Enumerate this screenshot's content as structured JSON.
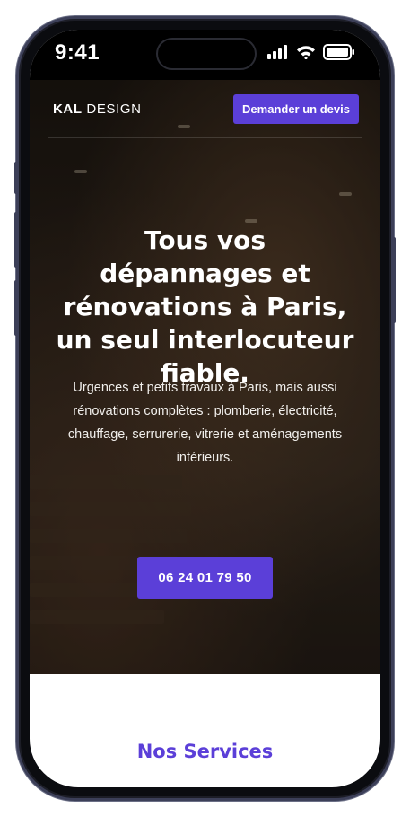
{
  "status_bar": {
    "time": "9:41",
    "icons": [
      "cellular-signal-icon",
      "wifi-icon",
      "battery-icon"
    ]
  },
  "header": {
    "logo_bold": "KAL",
    "logo_rest": "DESIGN",
    "cta_label": "Demander un devis"
  },
  "hero": {
    "headline": "Tous vos dépannages et rénovations à Paris, un seul interlocuteur fiable.",
    "subtext": "Urgences et petits travaux à Paris, mais aussi rénovations complètes : plomberie, électricité, chauffage, serrurerie, vitrerie et aménagements intérieurs.",
    "phone_label": "06 24 01 79 50"
  },
  "services": {
    "title": "Nos Services"
  },
  "colors": {
    "accent": "#5b3fd8",
    "frame": "#3c3f58"
  }
}
